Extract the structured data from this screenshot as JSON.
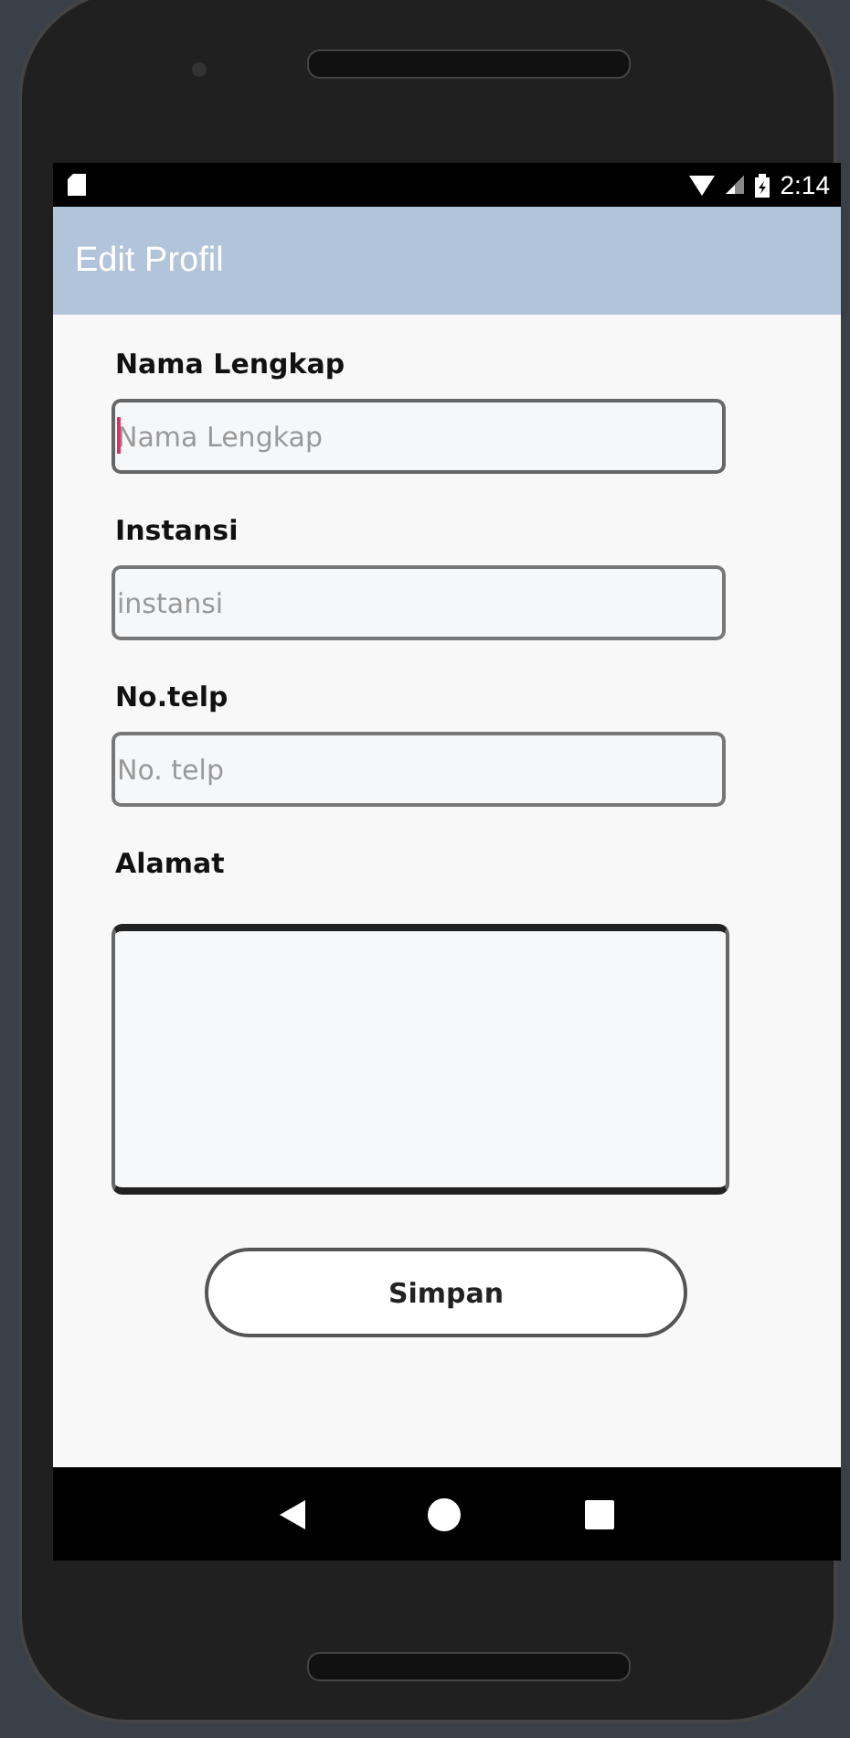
{
  "status_bar": {
    "time": "2:14"
  },
  "app_bar": {
    "title": "Edit Profil"
  },
  "fields": [
    {
      "label": "Nama Lengkap",
      "placeholder": "Nama Lengkap",
      "kind": "input",
      "focused": true
    },
    {
      "label": "Instansi",
      "placeholder": "instansi",
      "kind": "input",
      "focused": false
    },
    {
      "label": "No.telp",
      "placeholder": "No. telp",
      "kind": "input",
      "focused": false
    },
    {
      "label": "Alamat",
      "kind": "textarea",
      "focused": false
    }
  ],
  "button": {
    "label": "Simpan"
  }
}
